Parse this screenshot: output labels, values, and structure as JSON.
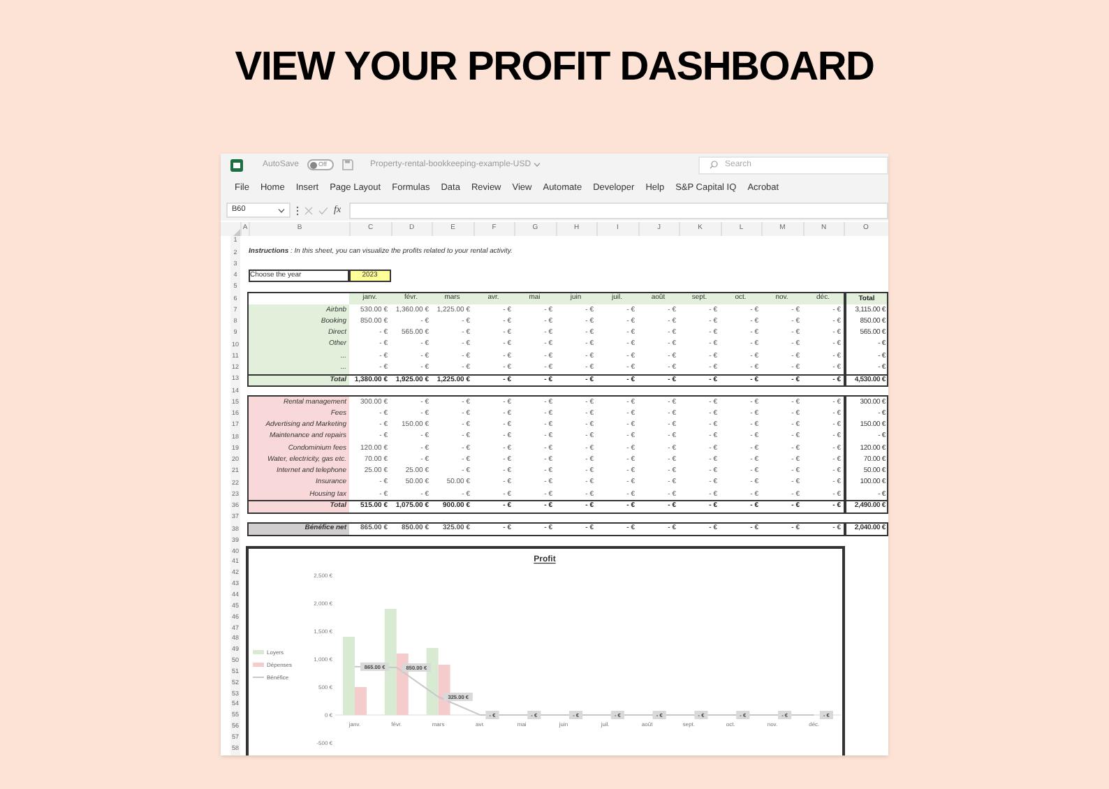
{
  "heading": "VIEW YOUR PROFIT DASHBOARD",
  "window": {
    "autosave": {
      "label": "AutoSave",
      "toggle": "Off",
      "on": false
    },
    "title": "Property-rental-bookkeeping-example-USD",
    "search": {
      "placeholder": "Search"
    }
  },
  "menu": [
    "File",
    "Home",
    "Insert",
    "Page Layout",
    "Formulas",
    "Data",
    "Review",
    "View",
    "Automate",
    "Developer",
    "Help",
    "S&P Capital IQ",
    "Acrobat"
  ],
  "formula_bar": {
    "name_box": "B60",
    "function_label": "fx"
  },
  "columns": [
    "A",
    "B",
    "C",
    "D",
    "E",
    "F",
    "G",
    "H",
    "I",
    "J",
    "K",
    "L",
    "M",
    "N",
    "O"
  ],
  "row_numbers": [
    "1",
    "2",
    "3",
    "4",
    "5",
    "6",
    "7",
    "8",
    "9",
    "10",
    "11",
    "12",
    "13",
    "14",
    "15",
    "16",
    "17",
    "18",
    "19",
    "20",
    "21",
    "22",
    "23",
    "36",
    "37",
    "38",
    "39",
    "40",
    "41",
    "42",
    "43",
    "44",
    "45",
    "46",
    "47",
    "48",
    "49",
    "50",
    "51",
    "52",
    "53",
    "54",
    "55",
    "56",
    "57",
    "58"
  ],
  "instructions": "**Instructions** : In this sheet, you can visualize the profits related to your rental activity.",
  "year": {
    "label": "Choose the year",
    "value": "2023"
  },
  "months": [
    "janv.",
    "févr.",
    "mars",
    "avr.",
    "mai",
    "juin",
    "juil.",
    "août",
    "sept.",
    "oct.",
    "nov.",
    "déc."
  ],
  "total_header": "Total",
  "income": {
    "rows": [
      {
        "label": "Airbnb",
        "values": [
          "530.00 €",
          "1,360.00 €",
          "1,225.00 €",
          "- €",
          "- €",
          "- €",
          "- €",
          "- €",
          "- €",
          "- €",
          "- €",
          "- €"
        ],
        "total": "3,115.00 €"
      },
      {
        "label": "Booking",
        "values": [
          "850.00 €",
          "- €",
          "- €",
          "- €",
          "- €",
          "- €",
          "- €",
          "- €",
          "- €",
          "- €",
          "- €",
          "- €"
        ],
        "total": "850.00 €"
      },
      {
        "label": "Direct",
        "values": [
          "- €",
          "565.00 €",
          "- €",
          "- €",
          "- €",
          "- €",
          "- €",
          "- €",
          "- €",
          "- €",
          "- €",
          "- €"
        ],
        "total": "565.00 €"
      },
      {
        "label": "Other",
        "values": [
          "- €",
          "- €",
          "- €",
          "- €",
          "- €",
          "- €",
          "- €",
          "- €",
          "- €",
          "- €",
          "- €",
          "- €"
        ],
        "total": "- €"
      },
      {
        "label": "...",
        "values": [
          "- €",
          "- €",
          "- €",
          "- €",
          "- €",
          "- €",
          "- €",
          "- €",
          "- €",
          "- €",
          "- €",
          "- €"
        ],
        "total": "- €"
      },
      {
        "label": "...",
        "values": [
          "- €",
          "- €",
          "- €",
          "- €",
          "- €",
          "- €",
          "- €",
          "- €",
          "- €",
          "- €",
          "- €",
          "- €"
        ],
        "total": "- €"
      }
    ],
    "total": {
      "label": "Total",
      "values": [
        "1,380.00 €",
        "1,925.00 €",
        "1,225.00 €",
        "- €",
        "- €",
        "- €",
        "- €",
        "- €",
        "- €",
        "- €",
        "- €",
        "- €"
      ],
      "total": "4,530.00 €"
    }
  },
  "expenses": {
    "rows": [
      {
        "label": "Rental management",
        "values": [
          "300.00 €",
          "- €",
          "- €",
          "- €",
          "- €",
          "- €",
          "- €",
          "- €",
          "- €",
          "- €",
          "- €",
          "- €"
        ],
        "total": "300.00 €"
      },
      {
        "label": "Fees",
        "values": [
          "- €",
          "- €",
          "- €",
          "- €",
          "- €",
          "- €",
          "- €",
          "- €",
          "- €",
          "- €",
          "- €",
          "- €"
        ],
        "total": "- €"
      },
      {
        "label": "Advertising and Marketing",
        "values": [
          "- €",
          "150.00 €",
          "- €",
          "- €",
          "- €",
          "- €",
          "- €",
          "- €",
          "- €",
          "- €",
          "- €",
          "- €"
        ],
        "total": "150.00 €"
      },
      {
        "label": "Maintenance and repairs",
        "values": [
          "- €",
          "- €",
          "- €",
          "- €",
          "- €",
          "- €",
          "- €",
          "- €",
          "- €",
          "- €",
          "- €",
          "- €"
        ],
        "total": "- €"
      },
      {
        "label": "Condominium fees",
        "values": [
          "120.00 €",
          "- €",
          "- €",
          "- €",
          "- €",
          "- €",
          "- €",
          "- €",
          "- €",
          "- €",
          "- €",
          "- €"
        ],
        "total": "120.00 €"
      },
      {
        "label": "Water, electricity, gas etc.",
        "values": [
          "70.00 €",
          "- €",
          "- €",
          "- €",
          "- €",
          "- €",
          "- €",
          "- €",
          "- €",
          "- €",
          "- €",
          "- €"
        ],
        "total": "70.00 €"
      },
      {
        "label": "Internet and telephone",
        "values": [
          "25.00 €",
          "25.00 €",
          "- €",
          "- €",
          "- €",
          "- €",
          "- €",
          "- €",
          "- €",
          "- €",
          "- €",
          "- €"
        ],
        "total": "50.00 €"
      },
      {
        "label": "Insurance",
        "values": [
          "- €",
          "50.00 €",
          "50.00 €",
          "- €",
          "- €",
          "- €",
          "- €",
          "- €",
          "- €",
          "- €",
          "- €",
          "- €"
        ],
        "total": "100.00 €"
      },
      {
        "label": "Housing tax",
        "values": [
          "- €",
          "- €",
          "- €",
          "- €",
          "- €",
          "- €",
          "- €",
          "- €",
          "- €",
          "- €",
          "- €",
          "- €"
        ],
        "total": "- €"
      }
    ],
    "total": {
      "label": "Total",
      "values": [
        "515.00 €",
        "1,075.00 €",
        "900.00 €",
        "- €",
        "- €",
        "- €",
        "- €",
        "- €",
        "- €",
        "- €",
        "- €",
        "- €"
      ],
      "total": "2,490.00 €"
    }
  },
  "net_profit": {
    "label": "Bénéfice net",
    "values": [
      "865.00 €",
      "850.00 €",
      "325.00 €",
      "- €",
      "- €",
      "- €",
      "- €",
      "- €",
      "- €",
      "- €",
      "- €",
      "- €"
    ],
    "total": "2,040.00 €"
  },
  "chart": {
    "chart_data": {
      "type": "bar",
      "title": "Profit",
      "categories": [
        "janv.",
        "févr.",
        "mars",
        "avr.",
        "mai",
        "juin",
        "juil.",
        "août",
        "sept.",
        "oct.",
        "nov.",
        "déc."
      ],
      "series": [
        {
          "name": "Loyers",
          "type": "bar",
          "color": "#d9ead3",
          "values": [
            1400,
            1900,
            1200,
            0,
            0,
            0,
            0,
            0,
            0,
            0,
            0,
            0
          ]
        },
        {
          "name": "Dépenses",
          "type": "bar",
          "color": "#f4cccc",
          "values": [
            500,
            1100,
            900,
            0,
            0,
            0,
            0,
            0,
            0,
            0,
            0,
            0
          ]
        },
        {
          "name": "Bénéfice",
          "type": "line",
          "color": "#c8c8c8",
          "values": [
            865,
            850,
            325,
            0,
            0,
            0,
            0,
            0,
            0,
            0,
            0,
            0
          ],
          "value_labels": [
            "865.00 €",
            "850.00 €",
            "325.00 €",
            "- €",
            "- €",
            "- €",
            "- €",
            "- €",
            "- €",
            "- €",
            "- €",
            "- €"
          ]
        }
      ],
      "ylim": [
        -500,
        2500
      ],
      "legend": "left",
      "yticks": [
        {
          "value": -500,
          "label": "-500 €"
        },
        {
          "value": 0,
          "label": "0 €"
        },
        {
          "value": 500,
          "label": "500 €"
        },
        {
          "value": 1000,
          "label": "1,000 €"
        },
        {
          "value": 1500,
          "label": "1,500 €"
        },
        {
          "value": 2000,
          "label": "2,000 €"
        },
        {
          "value": 2500,
          "label": "2,500 €"
        }
      ]
    }
  }
}
